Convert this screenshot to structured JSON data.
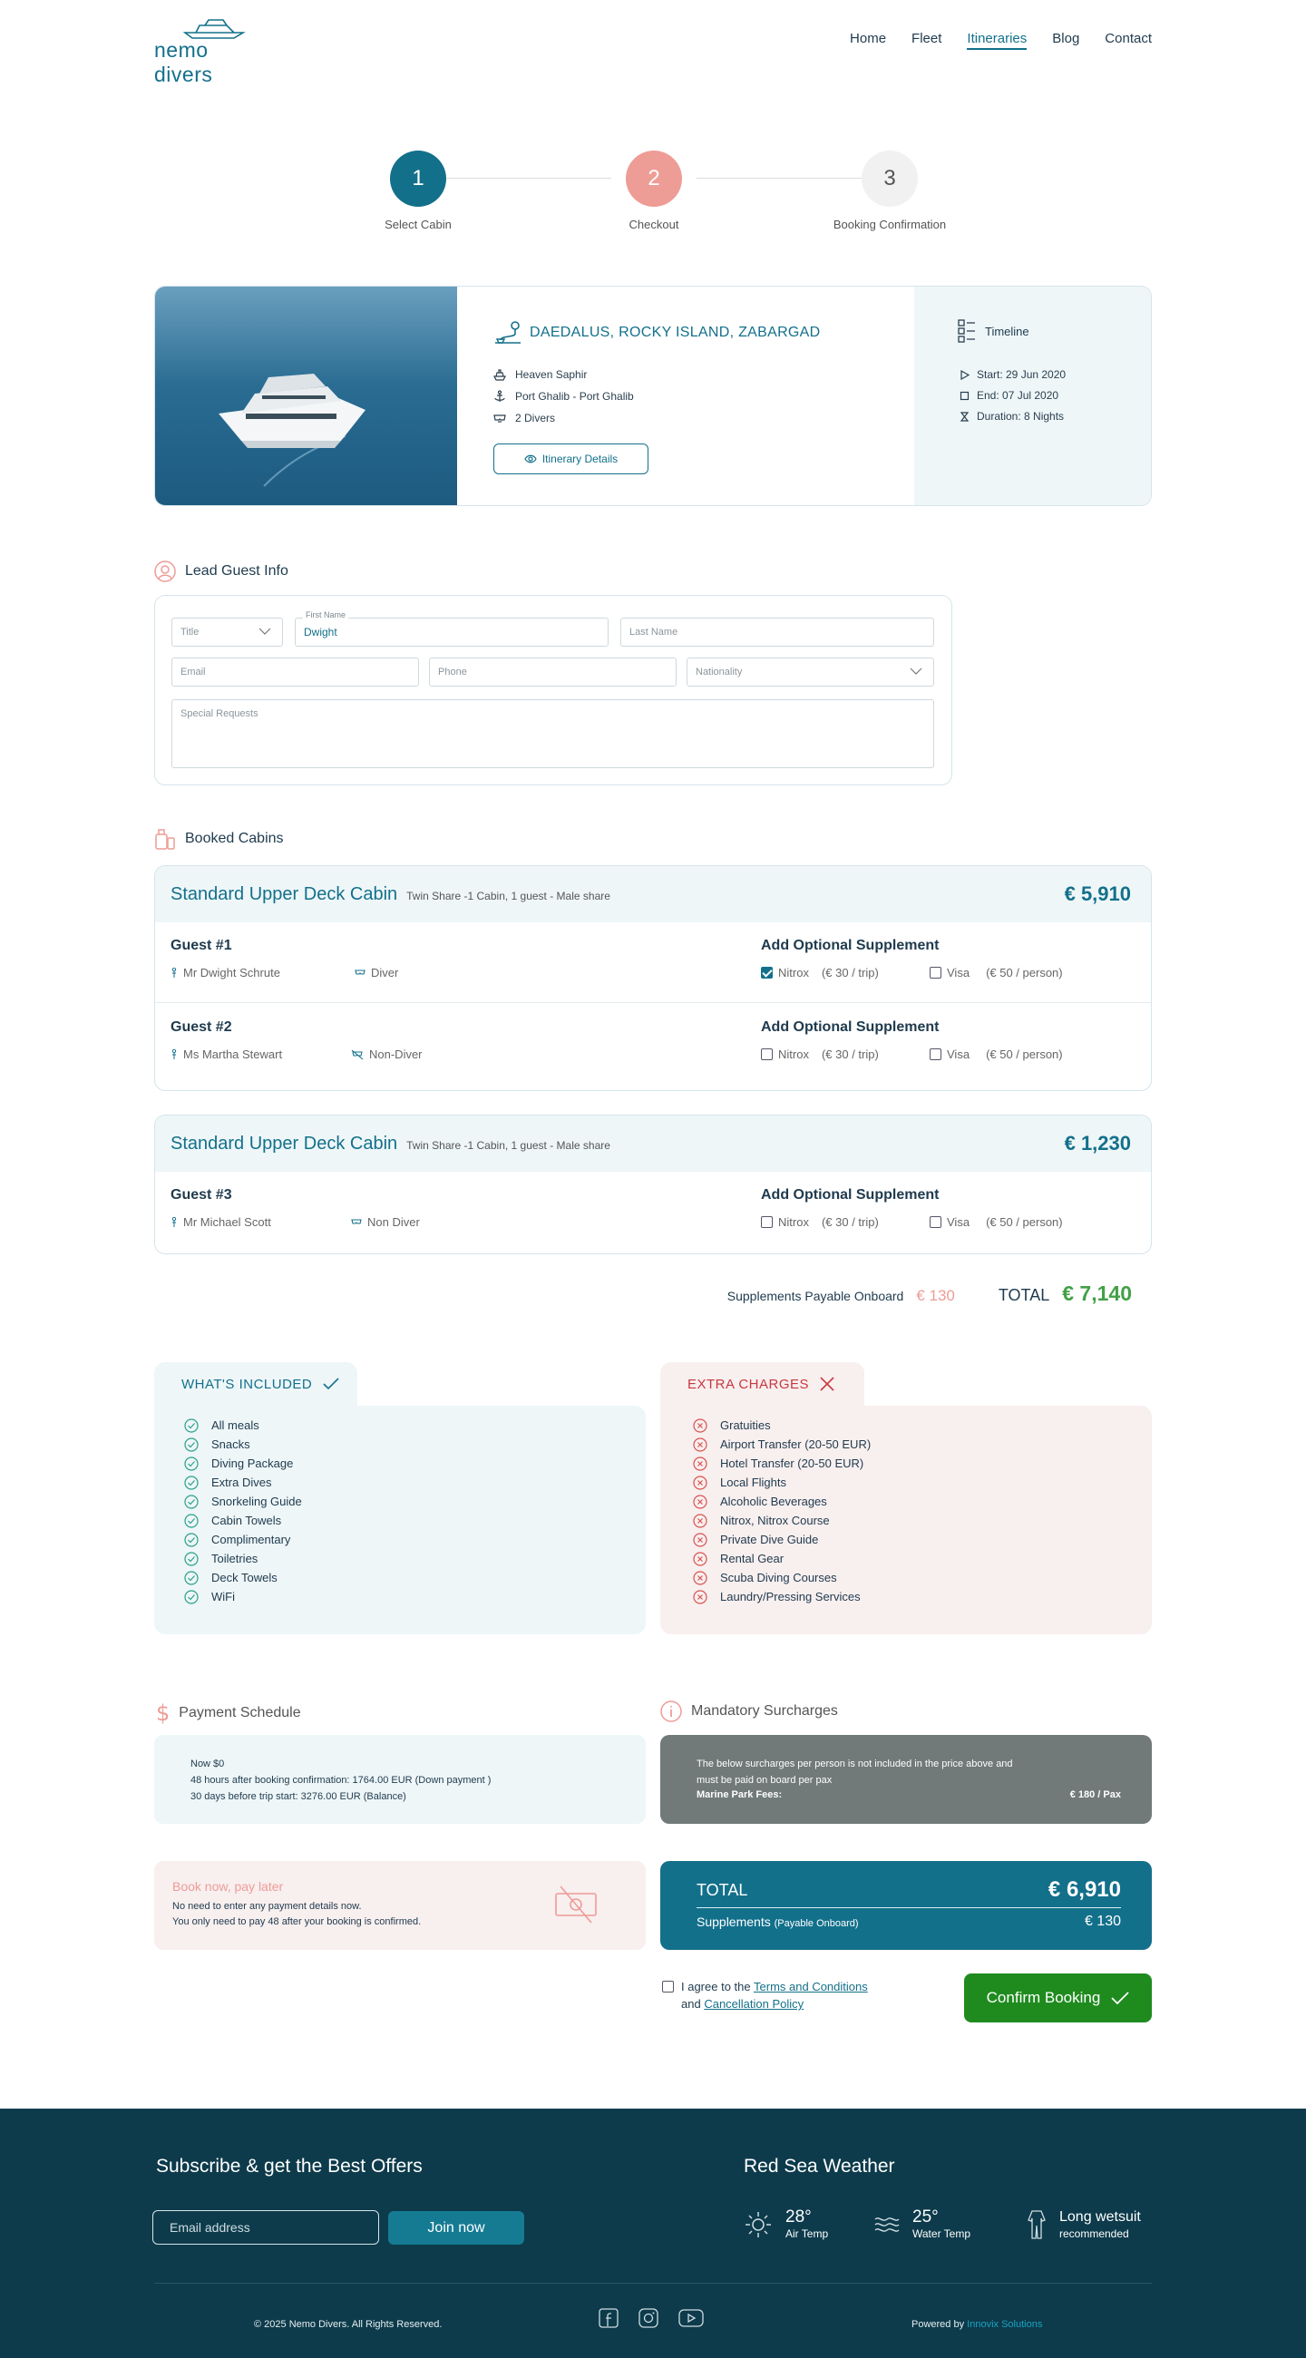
{
  "brand": {
    "name": "nemo divers"
  },
  "nav": [
    "Home",
    "Fleet",
    "Itineraries",
    "Blog",
    "Contact"
  ],
  "steps": [
    {
      "number": "1",
      "label": "Select Cabin"
    },
    {
      "number": "2",
      "label": "Checkout"
    },
    {
      "number": "3",
      "label": "Booking Confirmation"
    }
  ],
  "trip": {
    "title": "DAEDALUS, ROCKY ISLAND, ZABARGAD",
    "boat": "Heaven Saphir",
    "port": "Port Ghalib - Port Ghalib",
    "divers": "2 Divers",
    "details_button": "Itinerary Details",
    "timeline_label": "Timeline",
    "start": "Start: 29 Jun 2020",
    "end": "End: 07 Jul 2020",
    "duration": "Duration: 8 Nights"
  },
  "lead_guest": {
    "section_title": "Lead Guest Info",
    "title_placeholder": "Title",
    "first_name_label": "First Name",
    "first_name_value": "Dwight",
    "last_name_placeholder": "Last Name",
    "email_placeholder": "Email",
    "phone_placeholder": "Phone",
    "nationality_placeholder": "Nationality",
    "requests_placeholder": "Special Requests"
  },
  "booked_cabins": {
    "section_title": "Booked Cabins",
    "supplement_title": "Add Optional Supplement",
    "cabins": [
      {
        "name": "Standard Upper Deck Cabin",
        "subtitle": "Twin Share -1 Cabin, 1 guest - Male share",
        "price": "€ 5,910",
        "guests": [
          {
            "label": "Guest #1",
            "name": "Mr Dwight Schrute",
            "type": "Diver",
            "nitrox": true,
            "visa": false
          },
          {
            "label": "Guest #2",
            "name": "Ms Martha Stewart",
            "type": "Non-Diver",
            "nitrox": false,
            "visa": false
          }
        ]
      },
      {
        "name": "Standard Upper Deck Cabin",
        "subtitle": "Twin Share -1 Cabin, 1 guest - Male share",
        "price": "€ 1,230",
        "guests": [
          {
            "label": "Guest #3",
            "name": "Mr Michael Scott",
            "type": "Non Diver",
            "nitrox": false,
            "visa": false
          }
        ]
      }
    ],
    "nitrox_label": "Nitrox",
    "nitrox_price": "(€ 30 / trip)",
    "visa_label": "Visa",
    "visa_price": "(€ 50 / person)"
  },
  "totals": {
    "supplements_label": "Supplements Payable Onboard",
    "supplements_value": "€ 130",
    "total_label": "TOTAL",
    "total_value": "€ 7,140"
  },
  "included": {
    "title": "WHAT'S INCLUDED",
    "items": [
      "All meals",
      "Snacks",
      "Diving Package",
      "Extra Dives",
      "Snorkeling Guide",
      "Cabin Towels",
      "Complimentary",
      "Toiletries",
      "Deck Towels",
      "WiFi"
    ]
  },
  "extras": {
    "title": "EXTRA CHARGES",
    "items": [
      "Gratuities",
      "Airport Transfer (20-50 EUR)",
      "Hotel Transfer (20-50 EUR)",
      "Local Flights",
      "Alcoholic Beverages",
      "Nitrox, Nitrox Course",
      "Private Dive Guide",
      "Rental Gear",
      "Scuba Diving Courses",
      "Laundry/Pressing Services"
    ]
  },
  "payment": {
    "title": "Payment Schedule",
    "line1": "Now $0",
    "line2": "48 hours after booking confirmation: 1764.00 EUR (Down payment )",
    "line3": "30 days before trip start: 3276.00 EUR (Balance)"
  },
  "surcharges": {
    "title": "Mandatory Surcharges",
    "note_line1": "The below surcharges per person is not included in the price above and",
    "note_line2": "must be paid on board per pax",
    "fee_label": "Marine Park Fees:",
    "fee_value": "€ 180 / Pax"
  },
  "book_now": {
    "title": "Book now, pay later",
    "line1": "No need to enter any payment details now.",
    "line2": "You only need to pay 48 after your booking is confirmed."
  },
  "total_box": {
    "total_label": "TOTAL",
    "total_value": "€ 6,910",
    "supp_label": "Supplements",
    "supp_note": "(Payable Onboard)",
    "supp_value": "€ 130"
  },
  "agreement": {
    "prefix": "I agree to the",
    "terms_link": "Terms and Conditions",
    "and": "and",
    "cancel_link": "Cancellation Policy"
  },
  "confirm_button": "Confirm Booking",
  "footer": {
    "subscribe_title": "Subscribe & get the Best Offers",
    "email_placeholder": "Email address",
    "join_button": "Join now",
    "weather_title": "Red Sea Weather",
    "air_temp_value": "28°",
    "air_temp_label": "Air Temp",
    "water_temp_value": "25°",
    "water_temp_label": "Water Temp",
    "wetsuit_value": "Long wetsuit",
    "wetsuit_label": "recommended",
    "copyright": "© 2025 Nemo Divers. All Rights Reserved.",
    "powered_prefix": "Powered by",
    "powered_by": "Innovix Solutions"
  },
  "colors": {
    "primary": "#13708b",
    "coral": "#ee9c96",
    "green": "#1f8b1f",
    "footer_bg": "#0d3b4b"
  }
}
